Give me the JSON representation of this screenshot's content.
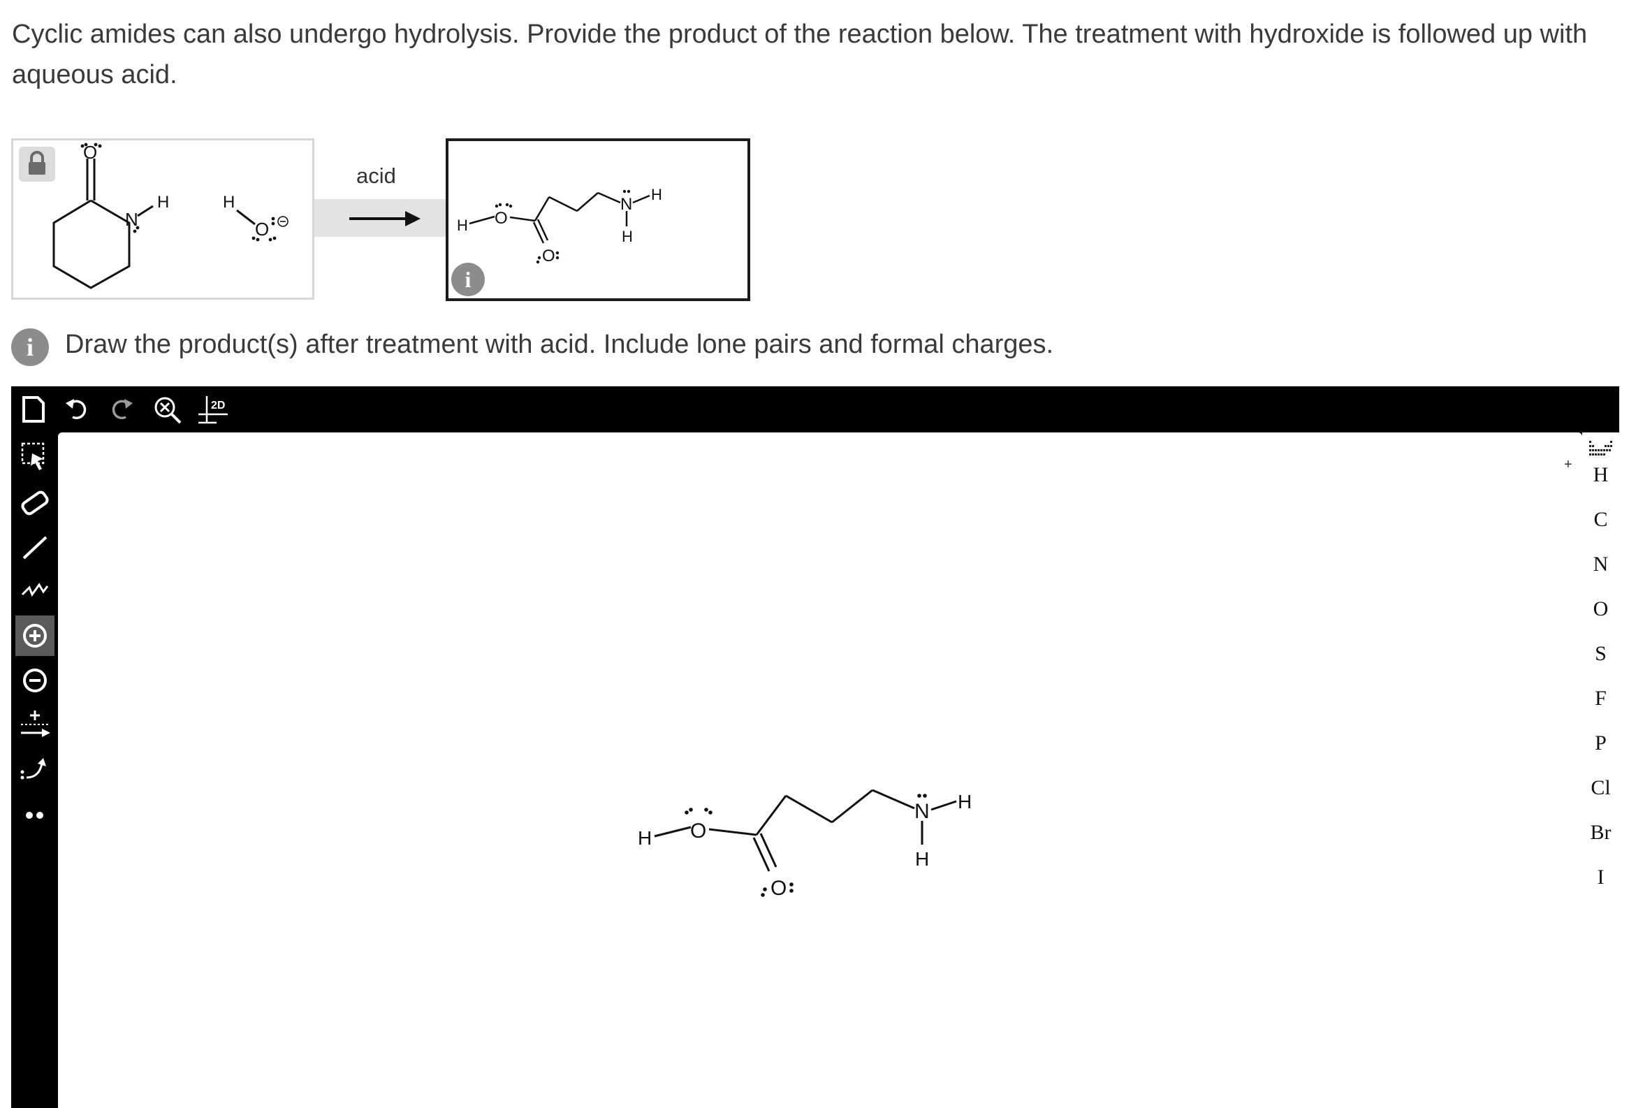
{
  "question": {
    "text": "Cyclic amides can also undergo hydrolysis. Provide the product of the reaction below. The treatment with hydroxide is followed up with aqueous acid."
  },
  "reaction": {
    "reagent_label": "acid",
    "left_atoms": {
      "o": "O",
      "n": "N",
      "h": "H"
    },
    "right_atoms": {
      "o": "O",
      "n": "N",
      "h": "H"
    },
    "info_glyph": "i"
  },
  "instruction": {
    "text": "Draw the product(s) after treatment with acid. Include lone pairs and formal charges."
  },
  "editor": {
    "top_tools": [
      "new-document-icon",
      "undo-icon",
      "redo-icon",
      "zoom-clear-icon",
      "clean-2d-icon"
    ],
    "clean_label": "2D",
    "left_tools": [
      "select-rectangle-icon",
      "eraser-icon",
      "single-bond-icon",
      "chain-icon",
      "positive-charge-icon",
      "negative-charge-icon",
      "reaction-arrow-icon",
      "curved-arrow-icon",
      "lone-pair-icon"
    ],
    "active_tool": "positive-charge-icon",
    "elements": [
      "H",
      "C",
      "N",
      "O",
      "S",
      "F",
      "P",
      "Cl",
      "Br",
      "I"
    ],
    "periodic_table_icon": "periodic-table-icon",
    "canvas_plus": "+",
    "canvas_atoms": {
      "o": "O",
      "n": "N",
      "h": "H"
    }
  },
  "colors": {
    "editor_bar": "#000000",
    "active_tool_bg": "#5a5a5a",
    "info_badge": "#8c8c8c",
    "arrow_band": "#e3e3e3"
  }
}
